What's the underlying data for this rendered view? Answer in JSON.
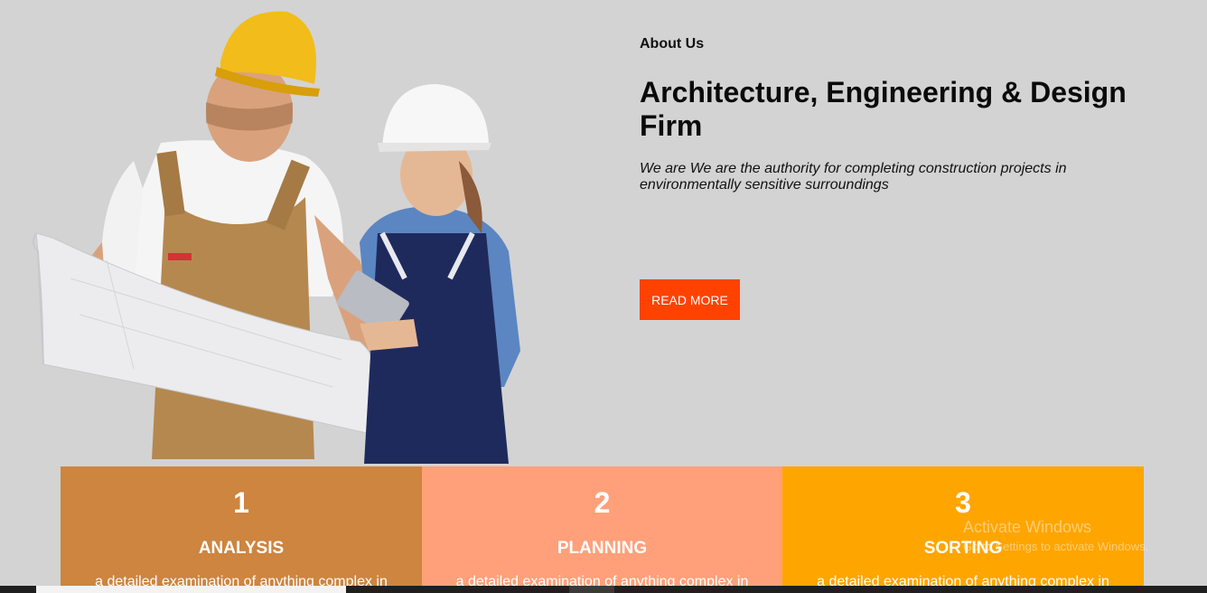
{
  "about": {
    "label": "About Us",
    "title": "Architecture, Engineering & Design Firm",
    "description": "We are We are the authority for completing construction projects in environmentally sensitive surroundings",
    "read_more_label": "READ MORE"
  },
  "steps": [
    {
      "number": "1",
      "title": "ANALYSIS",
      "description": "a detailed examination of anything complex in",
      "color": "#cd853f"
    },
    {
      "number": "2",
      "title": "PLANNING",
      "description": "a detailed examination of anything complex in",
      "color": "#ffa07a"
    },
    {
      "number": "3",
      "title": "SORTING",
      "description": "a detailed examination of anything complex in",
      "color": "#ffa500"
    }
  ],
  "watermark": {
    "title": "Activate Windows",
    "subtitle": "Go to Settings to activate Windows."
  },
  "colors": {
    "background": "#d3d3d3",
    "accent": "#ff4200"
  }
}
